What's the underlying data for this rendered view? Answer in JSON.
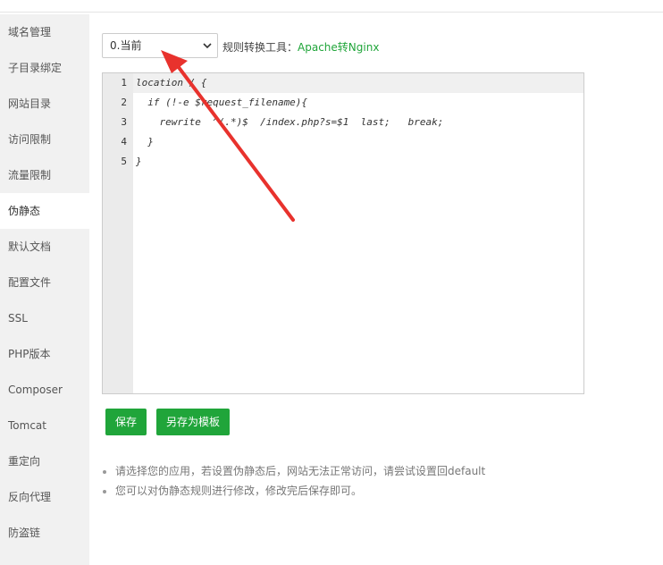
{
  "sidebar": {
    "items": [
      {
        "label": "域名管理"
      },
      {
        "label": "子目录绑定"
      },
      {
        "label": "网站目录"
      },
      {
        "label": "访问限制"
      },
      {
        "label": "流量限制"
      },
      {
        "label": "伪静态",
        "active": true
      },
      {
        "label": "默认文档"
      },
      {
        "label": "配置文件"
      },
      {
        "label": "SSL"
      },
      {
        "label": "PHP版本"
      },
      {
        "label": "Composer"
      },
      {
        "label": "Tomcat"
      },
      {
        "label": "重定向"
      },
      {
        "label": "反向代理"
      },
      {
        "label": "防盗链"
      }
    ]
  },
  "rewrite": {
    "selected_rule": "0.当前",
    "tool_label": "规则转换工具：",
    "tool_link": "Apache转Nginx"
  },
  "editor": {
    "line_numbers": [
      "1",
      "2",
      "3",
      "4",
      "5"
    ],
    "lines": [
      "location / {",
      "  if (!-e $request_filename){",
      "    rewrite  ^(.*)$  /index.php?s=$1  last;   break;",
      "  }",
      "}"
    ]
  },
  "buttons": {
    "save": "保存",
    "save_as_template": "另存为模板"
  },
  "tips": [
    "请选择您的应用，若设置伪静态后，网站无法正常访问，请尝试设置回default",
    "您可以对伪静态规则进行修改，修改完后保存即可。"
  ],
  "colors": {
    "accent": "#20a53a",
    "arrow": "#e8322d"
  }
}
